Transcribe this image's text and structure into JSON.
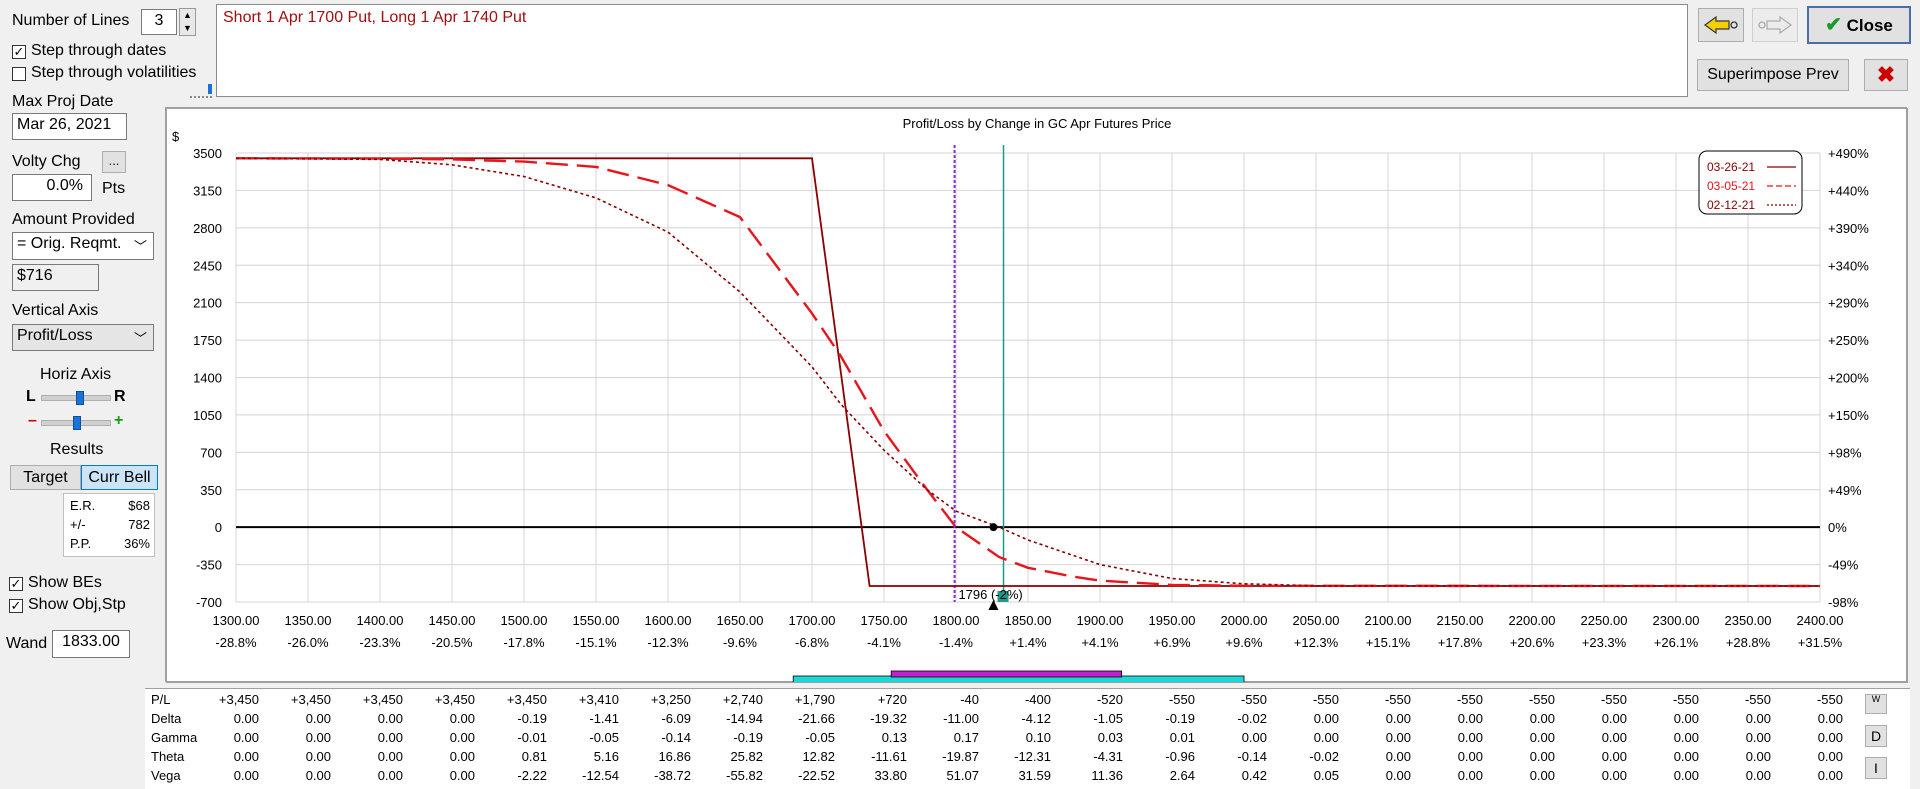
{
  "left_panel": {
    "number_of_lines_label": "Number of Lines",
    "number_of_lines_value": "3",
    "step_dates_label": "Step through dates",
    "step_dates_checked": true,
    "step_vols_label": "Step through volatilities",
    "step_vols_checked": false,
    "max_proj_date_label": "Max Proj Date",
    "max_proj_date_value": "Mar 26, 2021",
    "volty_chg_label": "Volty Chg",
    "volty_chg_button": "...",
    "volty_chg_value": "0.0%",
    "volty_chg_unit": "Pts",
    "amount_provided_label": "Amount Provided",
    "amount_provided_value": "= Orig. Reqmt.",
    "amount_value": "$716",
    "vertical_axis_label": "Vertical Axis",
    "vertical_axis_value": "Profit/Loss",
    "horiz_axis_label": "Horiz Axis",
    "horiz_l": "L",
    "horiz_r": "R",
    "zoom_minus": "–",
    "zoom_plus": "+",
    "horiz_lr_pos": 0.55,
    "horiz_zoom_pos": 0.5,
    "results_label": "Results",
    "target_button": "Target",
    "curr_bell_button": "Curr Bell",
    "results": {
      "er_label": "E.R.",
      "er_value": "$68",
      "pm_label": "+/-",
      "pm_value": "782",
      "pp_label": "P.P.",
      "pp_value": "36%"
    },
    "show_bes_label": "Show BEs",
    "show_bes_checked": true,
    "show_obj_label": "Show Obj,Stp",
    "show_obj_checked": true,
    "wand_label": "Wand",
    "wand_value": "1833.00"
  },
  "description": "Short 1 Apr 1700 Put, Long 1 Apr 1740 Put",
  "toolbar": {
    "close_label": "Close",
    "superimpose_label": "Superimpose Prev"
  },
  "colors": {
    "dark_red": "#8b0000",
    "red": "#e8141c",
    "purple": "#8a2be2",
    "teal": "#1a9a8a",
    "cyan_bar": "#1ed8d8",
    "magenta_bar": "#c020d0",
    "text_red": "#a01010"
  },
  "chart_data": {
    "type": "line",
    "title": "Profit/Loss by Change in GC Apr Futures Price",
    "ylabel": "$",
    "y_ticks": [
      3500,
      3150,
      2800,
      2450,
      2100,
      1750,
      1400,
      1050,
      700,
      350,
      0,
      -350,
      -700
    ],
    "ylim": [
      -700,
      3500
    ],
    "y2_ticks": [
      "+490%",
      "+440%",
      "+390%",
      "+340%",
      "+290%",
      "+250%",
      "+200%",
      "+150%",
      "+98%",
      "+49%",
      "0%",
      "-49%",
      "-98%"
    ],
    "x_ticks": [
      1300,
      1350,
      1400,
      1450,
      1500,
      1550,
      1600,
      1650,
      1700,
      1750,
      1800,
      1850,
      1900,
      1950,
      2000,
      2050,
      2100,
      2150,
      2200,
      2250,
      2300,
      2350,
      2400
    ],
    "x_tick_labels": [
      "1300.00",
      "1350.00",
      "1400.00",
      "1450.00",
      "1500.00",
      "1550.00",
      "1600.00",
      "1650.00",
      "1700.00",
      "1750.00",
      "1800.00",
      "1850.00",
      "1900.00",
      "1950.00",
      "2000.00",
      "2050.00",
      "2100.00",
      "2150.00",
      "2200.00",
      "2250.00",
      "2300.00",
      "2350.00",
      "2400.00"
    ],
    "x_pct_labels": [
      "-28.8%",
      "-26.0%",
      "-23.3%",
      "-20.5%",
      "-17.8%",
      "-15.1%",
      "-12.3%",
      "-9.6%",
      "-6.8%",
      "-4.1%",
      "-1.4%",
      "+1.4%",
      "+4.1%",
      "+6.9%",
      "+9.6%",
      "+12.3%",
      "+15.1%",
      "+17.8%",
      "+20.6%",
      "+23.3%",
      "+26.1%",
      "+28.8%",
      "+31.5%"
    ],
    "xlim": [
      1300,
      2400
    ],
    "series": [
      {
        "name": "03-26-21",
        "style": "solid",
        "x": [
          1300,
          1700,
          1740,
          2400
        ],
        "y": [
          3450,
          3450,
          -550,
          -550
        ]
      },
      {
        "name": "03-05-21",
        "style": "dashed",
        "x": [
          1300,
          1400,
          1450,
          1500,
          1550,
          1600,
          1650,
          1700,
          1720,
          1750,
          1780,
          1800,
          1830,
          1850,
          1880,
          1900,
          1950,
          2000,
          2400
        ],
        "y": [
          3450,
          3448,
          3440,
          3420,
          3370,
          3200,
          2900,
          2000,
          1600,
          900,
          350,
          0,
          -280,
          -380,
          -460,
          -500,
          -540,
          -548,
          -550
        ]
      },
      {
        "name": "02-12-21",
        "style": "dotted",
        "x": [
          1300,
          1400,
          1450,
          1500,
          1550,
          1600,
          1650,
          1700,
          1720,
          1750,
          1780,
          1800,
          1830,
          1850,
          1900,
          1950,
          2000,
          2050,
          2400
        ],
        "y": [
          3450,
          3440,
          3390,
          3280,
          3080,
          2760,
          2200,
          1500,
          1150,
          720,
          350,
          150,
          0,
          -120,
          -350,
          -480,
          -530,
          -548,
          -550
        ]
      }
    ],
    "legend_position": "top-right",
    "purple_line_x": 1799,
    "teal_line_x": 1833,
    "current_marker_x": 1826,
    "current_label": "1796 (-2%)",
    "grid": true,
    "cyan_range": [
      1680,
      2000
    ],
    "magenta_range": [
      1755,
      1915
    ]
  },
  "table": {
    "rows": [
      {
        "label": "P/L",
        "values": [
          "+3,450",
          "+3,450",
          "+3,450",
          "+3,450",
          "+3,450",
          "+3,410",
          "+3,250",
          "+2,740",
          "+1,790",
          "+720",
          "-40",
          "-400",
          "-520",
          "-550",
          "-550",
          "-550",
          "-550",
          "-550",
          "-550",
          "-550",
          "-550",
          "-550",
          "-550"
        ]
      },
      {
        "label": "Delta",
        "values": [
          "0.00",
          "0.00",
          "0.00",
          "0.00",
          "-0.19",
          "-1.41",
          "-6.09",
          "-14.94",
          "-21.66",
          "-19.32",
          "-11.00",
          "-4.12",
          "-1.05",
          "-0.19",
          "-0.02",
          "0.00",
          "0.00",
          "0.00",
          "0.00",
          "0.00",
          "0.00",
          "0.00",
          "0.00"
        ]
      },
      {
        "label": "Gamma",
        "values": [
          "0.00",
          "0.00",
          "0.00",
          "0.00",
          "-0.01",
          "-0.05",
          "-0.14",
          "-0.19",
          "-0.05",
          "0.13",
          "0.17",
          "0.10",
          "0.03",
          "0.01",
          "0.00",
          "0.00",
          "0.00",
          "0.00",
          "0.00",
          "0.00",
          "0.00",
          "0.00",
          "0.00"
        ]
      },
      {
        "label": "Theta",
        "values": [
          "0.00",
          "0.00",
          "0.00",
          "0.00",
          "0.81",
          "5.16",
          "16.86",
          "25.82",
          "12.82",
          "-11.61",
          "-19.87",
          "-12.31",
          "-4.31",
          "-0.96",
          "-0.14",
          "-0.02",
          "0.00",
          "0.00",
          "0.00",
          "0.00",
          "0.00",
          "0.00",
          "0.00"
        ]
      },
      {
        "label": "Vega",
        "values": [
          "0.00",
          "0.00",
          "0.00",
          "0.00",
          "-2.22",
          "-12.54",
          "-38.72",
          "-55.82",
          "-22.52",
          "33.80",
          "51.07",
          "31.59",
          "11.36",
          "2.64",
          "0.42",
          "0.05",
          "0.00",
          "0.00",
          "0.00",
          "0.00",
          "0.00",
          "0.00",
          "0.00"
        ]
      }
    ],
    "side_buttons": [
      "W",
      "D",
      "I"
    ]
  }
}
